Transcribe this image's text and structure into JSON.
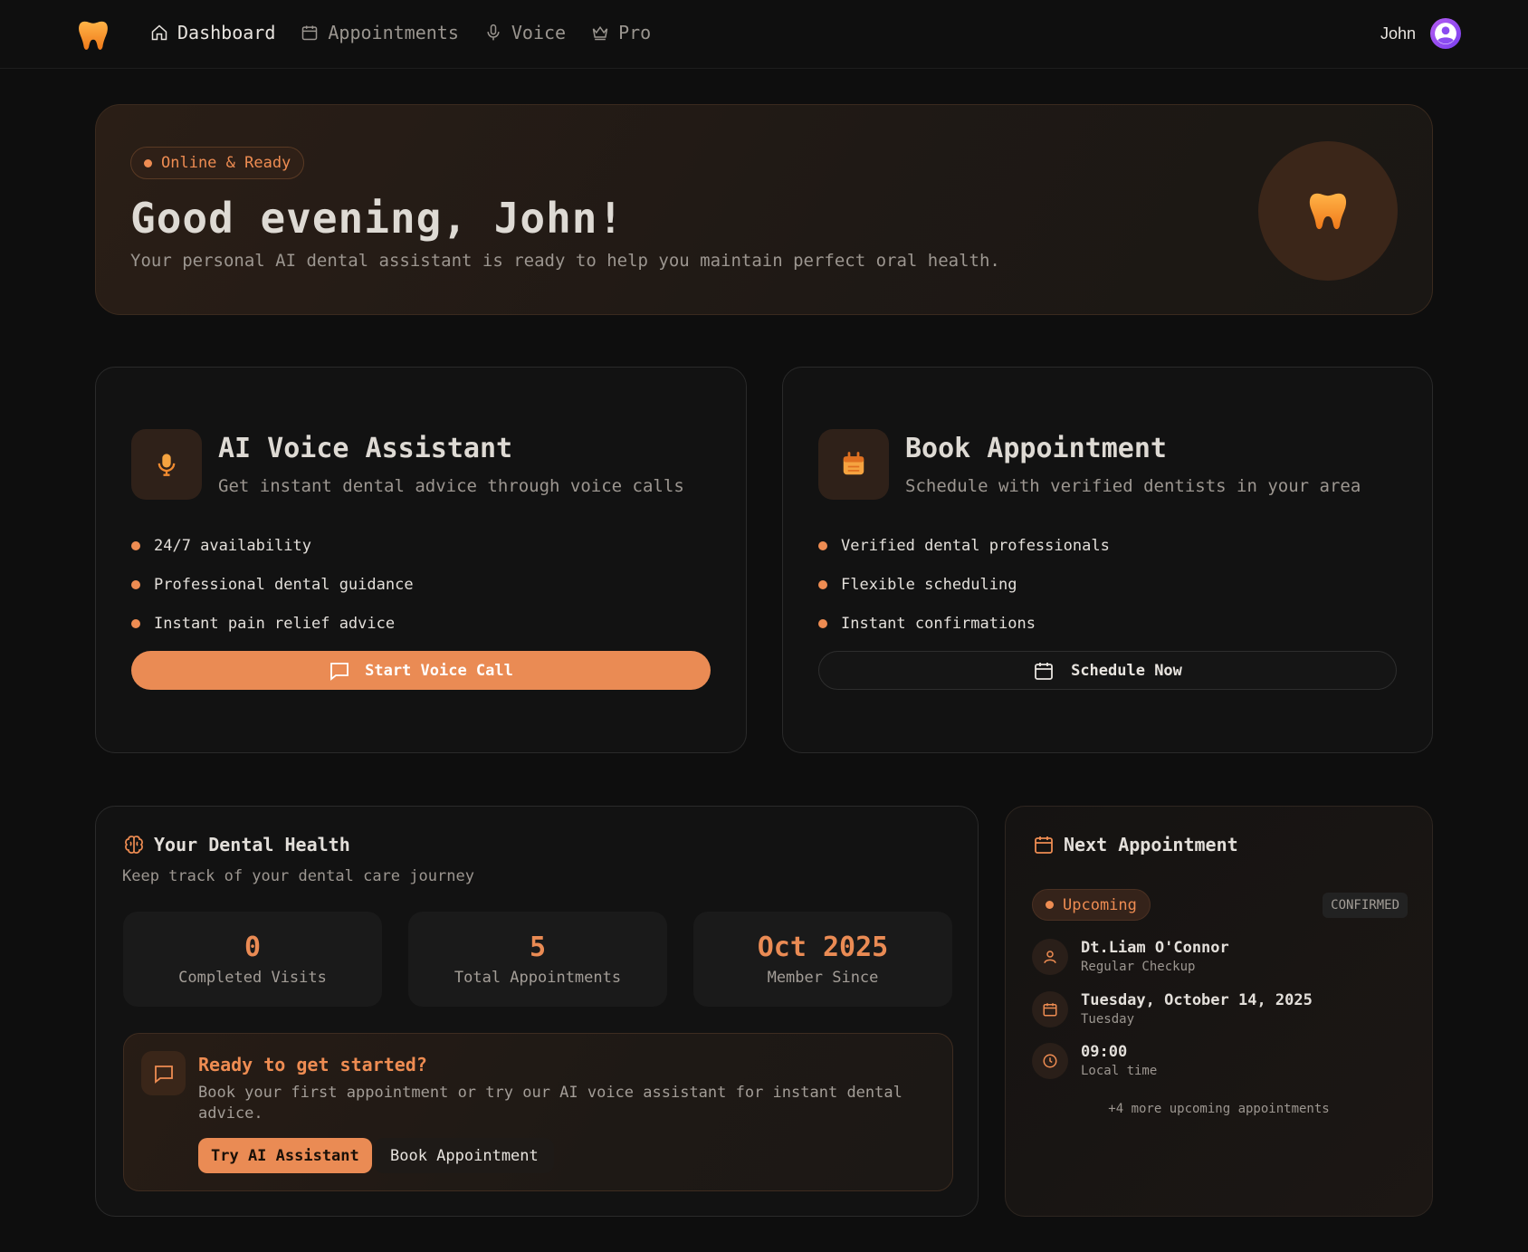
{
  "nav": {
    "items": [
      {
        "label": "Dashboard",
        "icon": "home-icon",
        "active": true
      },
      {
        "label": "Appointments",
        "icon": "calendar-icon",
        "active": false
      },
      {
        "label": "Voice",
        "icon": "mic-icon",
        "active": false
      },
      {
        "label": "Pro",
        "icon": "crown-icon",
        "active": false
      }
    ],
    "user_name": "John"
  },
  "hero": {
    "status": "Online & Ready",
    "greeting": "Good evening, John!",
    "subtitle": "Your personal AI dental assistant is ready to help you maintain perfect oral health."
  },
  "voice_card": {
    "title": "AI Voice Assistant",
    "subtitle": "Get instant dental advice through voice calls",
    "features": [
      "24/7 availability",
      "Professional dental guidance",
      "Instant pain relief advice"
    ],
    "button": "Start Voice Call"
  },
  "book_card": {
    "title": "Book Appointment",
    "subtitle": "Schedule with verified dentists in your area",
    "features": [
      "Verified dental professionals",
      "Flexible scheduling",
      "Instant confirmations"
    ],
    "button": "Schedule Now"
  },
  "health": {
    "title": "Your Dental Health",
    "subtitle": "Keep track of your dental care journey",
    "stats": [
      {
        "value": "0",
        "label": "Completed Visits"
      },
      {
        "value": "5",
        "label": "Total Appointments"
      },
      {
        "value": "Oct 2025",
        "label": "Member Since"
      }
    ],
    "cta": {
      "title": "Ready to get started?",
      "text": "Book your first appointment or try our AI voice assistant for instant dental advice.",
      "primary": "Try AI Assistant",
      "secondary": "Book Appointment"
    }
  },
  "next_appointment": {
    "title": "Next Appointment",
    "status": "Upcoming",
    "confirmation": "CONFIRMED",
    "doctor": "Dt.Liam O'Connor",
    "type": "Regular Checkup",
    "date": "Tuesday, October 14, 2025",
    "weekday": "Tuesday",
    "time": "09:00",
    "time_note": "Local time",
    "more": "+4 more upcoming appointments"
  },
  "colors": {
    "accent": "#ea8b54",
    "background": "#0e0e0e",
    "card": "#121212"
  }
}
